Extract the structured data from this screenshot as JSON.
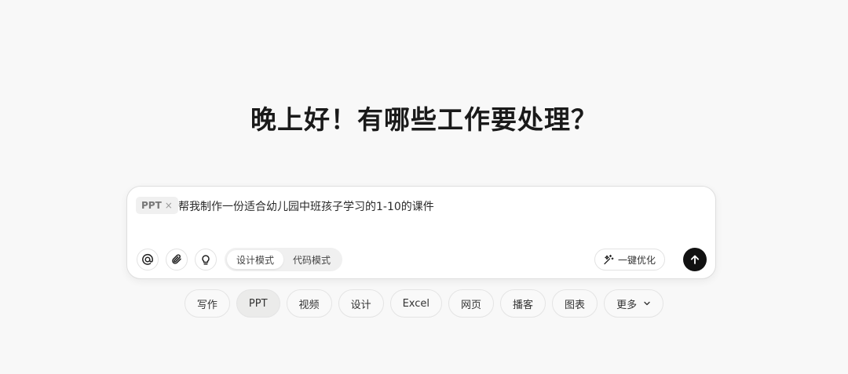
{
  "greeting": "晚上好！有哪些工作要处理？",
  "composer": {
    "mode_tag": "PPT",
    "mode_tag_close": "×",
    "prompt": "帮我制作一份适合幼儿园中班孩子学习的1-10的课件",
    "tools": [
      {
        "name": "mention",
        "icon": "at-icon"
      },
      {
        "name": "attach",
        "icon": "paperclip-icon"
      },
      {
        "name": "inspire",
        "icon": "lightbulb-icon"
      }
    ],
    "modes": [
      "设计模式",
      "代码模式"
    ],
    "active_mode": "设计模式",
    "optimize_label": "一键优化",
    "optimize_icon": "magic-wand-icon",
    "send_icon": "arrow-up-icon"
  },
  "chips": [
    {
      "label": "写作"
    },
    {
      "label": "PPT",
      "active": true
    },
    {
      "label": "视频"
    },
    {
      "label": "设计"
    },
    {
      "label": "Excel"
    },
    {
      "label": "网页"
    },
    {
      "label": "播客"
    },
    {
      "label": "图表"
    },
    {
      "label": "更多",
      "icon": "chevron-down-icon"
    }
  ],
  "colors": {
    "background": "#f8f8f8",
    "send_button": "#111111",
    "active_chip": "#ebebea"
  }
}
